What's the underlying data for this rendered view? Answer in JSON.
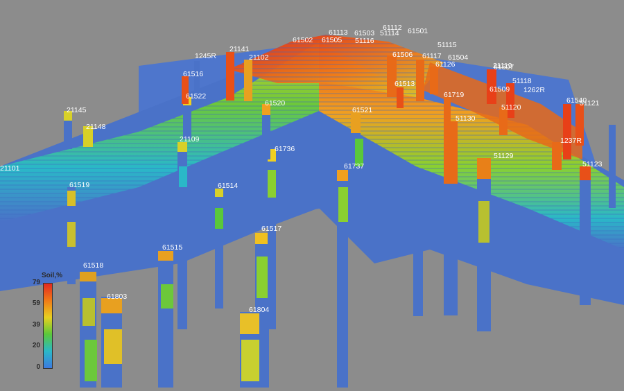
{
  "legend": {
    "title": "Soil,%",
    "ticks": [
      "79",
      "59",
      "39",
      "20",
      "0"
    ],
    "colors": [
      "#e32820",
      "#f07a18",
      "#e8d020",
      "#5ac83a",
      "#2ab8c8",
      "#3c7ae0"
    ]
  },
  "wells": [
    "21101",
    "61519",
    "21145",
    "21148",
    "21109",
    "61518",
    "61803",
    "61515",
    "61514",
    "61517",
    "61804",
    "61736",
    "61520",
    "61522",
    "61516",
    "1245R",
    "21141",
    "21102",
    "61502",
    "61505",
    "61113",
    "61503",
    "51116",
    "61112",
    "51114",
    "61501",
    "61506",
    "51115",
    "61117",
    "61504",
    "61126",
    "61513",
    "61521",
    "61737",
    "61719",
    "51130",
    "51129",
    "21119",
    "61507",
    "61509",
    "51118",
    "1262R",
    "51120",
    "61540",
    "51121",
    "1237R",
    "51123"
  ],
  "colors": {
    "background": "#8c8c8c",
    "section_blue": "#4a72c8",
    "label_text": "#ffffff"
  }
}
